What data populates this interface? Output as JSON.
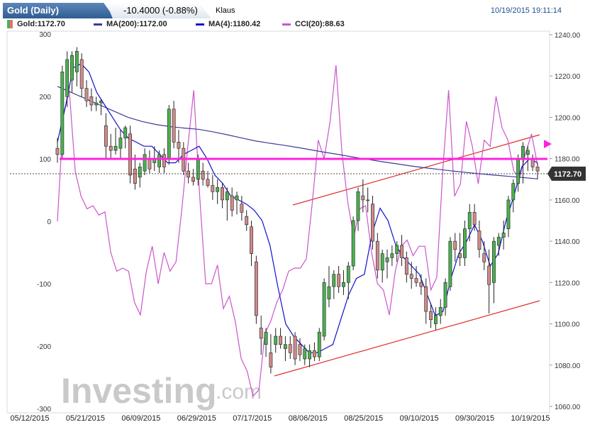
{
  "header": {
    "symbol_label": "Gold (Daily)",
    "change_label": "-10.4000 (-0.88%)",
    "user_label": "Klaus",
    "timestamp": "10/19/2015 19:11:14"
  },
  "watermark": {
    "brand": "Investing",
    "suffix": ".com"
  },
  "chart_data": {
    "type": "line",
    "legend": [
      {
        "label": "Gold:1172.70",
        "color": "#4caf50"
      },
      {
        "label": "MA(200):1172.00",
        "color": "#3b3b9a"
      },
      {
        "label": "MA(4):1180.42",
        "color": "#1010cc"
      },
      {
        "label": "CCI(20):88.63",
        "color": "#cc55cc"
      }
    ],
    "x_tick_labels": [
      "05/12/2015",
      "05/21/2015",
      "06/09/2015",
      "06/29/2015",
      "07/17/2015",
      "08/06/2015",
      "08/25/2015",
      "09/10/2015",
      "09/30/2015",
      "10/19/2015"
    ],
    "price_axis": {
      "ticks": [
        1240,
        1220,
        1200,
        1180,
        1160,
        1140,
        1120,
        1100,
        1080,
        1060
      ],
      "range": [
        1060,
        1240
      ]
    },
    "cci_axis": {
      "ticks": [
        300,
        200,
        100,
        0,
        -100,
        -200,
        -300
      ],
      "range": [
        -300,
        300
      ]
    },
    "last_price": 1172.7,
    "last_price_label": "1172.70",
    "cci_level": 100,
    "candles": [
      {
        "o": 1185,
        "h": 1190,
        "l": 1178,
        "c": 1182
      },
      {
        "o": 1182,
        "h": 1225,
        "l": 1180,
        "c": 1222
      },
      {
        "o": 1210,
        "h": 1232,
        "l": 1205,
        "c": 1228
      },
      {
        "o": 1218,
        "h": 1232,
        "l": 1212,
        "c": 1230
      },
      {
        "o": 1222,
        "h": 1234,
        "l": 1215,
        "c": 1232
      },
      {
        "o": 1228,
        "h": 1231,
        "l": 1210,
        "c": 1214
      },
      {
        "o": 1214,
        "h": 1218,
        "l": 1205,
        "c": 1208
      },
      {
        "o": 1210,
        "h": 1214,
        "l": 1203,
        "c": 1206
      },
      {
        "o": 1206,
        "h": 1210,
        "l": 1203,
        "c": 1207
      },
      {
        "o": 1207,
        "h": 1209,
        "l": 1201,
        "c": 1208
      },
      {
        "o": 1196,
        "h": 1202,
        "l": 1180,
        "c": 1186
      },
      {
        "o": 1186,
        "h": 1192,
        "l": 1180,
        "c": 1184
      },
      {
        "o": 1184,
        "h": 1195,
        "l": 1182,
        "c": 1186
      },
      {
        "o": 1185,
        "h": 1194,
        "l": 1180,
        "c": 1190
      },
      {
        "o": 1190,
        "h": 1196,
        "l": 1185,
        "c": 1195
      },
      {
        "o": 1192,
        "h": 1196,
        "l": 1168,
        "c": 1172
      },
      {
        "o": 1175,
        "h": 1182,
        "l": 1165,
        "c": 1168
      },
      {
        "o": 1171,
        "h": 1178,
        "l": 1166,
        "c": 1176
      },
      {
        "o": 1174,
        "h": 1185,
        "l": 1172,
        "c": 1182
      },
      {
        "o": 1180,
        "h": 1184,
        "l": 1173,
        "c": 1175
      },
      {
        "o": 1178,
        "h": 1186,
        "l": 1174,
        "c": 1180
      },
      {
        "o": 1176,
        "h": 1184,
        "l": 1173,
        "c": 1182
      },
      {
        "o": 1182,
        "h": 1185,
        "l": 1173,
        "c": 1176
      },
      {
        "o": 1180,
        "h": 1206,
        "l": 1177,
        "c": 1204
      },
      {
        "o": 1204,
        "h": 1208,
        "l": 1185,
        "c": 1188
      },
      {
        "o": 1188,
        "h": 1194,
        "l": 1178,
        "c": 1185
      },
      {
        "o": 1185,
        "h": 1188,
        "l": 1172,
        "c": 1174
      },
      {
        "o": 1174,
        "h": 1178,
        "l": 1168,
        "c": 1171
      },
      {
        "o": 1171,
        "h": 1175,
        "l": 1167,
        "c": 1169
      },
      {
        "o": 1170,
        "h": 1182,
        "l": 1167,
        "c": 1180
      },
      {
        "o": 1174,
        "h": 1178,
        "l": 1167,
        "c": 1170
      },
      {
        "o": 1170,
        "h": 1174,
        "l": 1166,
        "c": 1167
      },
      {
        "o": 1167,
        "h": 1172,
        "l": 1160,
        "c": 1164
      },
      {
        "o": 1164,
        "h": 1170,
        "l": 1158,
        "c": 1166
      },
      {
        "o": 1166,
        "h": 1168,
        "l": 1156,
        "c": 1160
      },
      {
        "o": 1160,
        "h": 1166,
        "l": 1150,
        "c": 1164
      },
      {
        "o": 1162,
        "h": 1166,
        "l": 1152,
        "c": 1155
      },
      {
        "o": 1160,
        "h": 1164,
        "l": 1153,
        "c": 1162
      },
      {
        "o": 1158,
        "h": 1162,
        "l": 1150,
        "c": 1154
      },
      {
        "o": 1152,
        "h": 1155,
        "l": 1145,
        "c": 1148
      },
      {
        "o": 1147,
        "h": 1150,
        "l": 1128,
        "c": 1134
      },
      {
        "o": 1130,
        "h": 1133,
        "l": 1100,
        "c": 1104
      },
      {
        "o": 1098,
        "h": 1104,
        "l": 1085,
        "c": 1093
      },
      {
        "o": 1090,
        "h": 1098,
        "l": 1084,
        "c": 1096
      },
      {
        "o": 1086,
        "h": 1095,
        "l": 1076,
        "c": 1079
      },
      {
        "o": 1090,
        "h": 1098,
        "l": 1086,
        "c": 1094
      },
      {
        "o": 1094,
        "h": 1098,
        "l": 1088,
        "c": 1090
      },
      {
        "o": 1088,
        "h": 1094,
        "l": 1082,
        "c": 1090
      },
      {
        "o": 1090,
        "h": 1094,
        "l": 1083,
        "c": 1086
      },
      {
        "o": 1094,
        "h": 1096,
        "l": 1080,
        "c": 1083
      },
      {
        "o": 1090,
        "h": 1093,
        "l": 1082,
        "c": 1085
      },
      {
        "o": 1083,
        "h": 1090,
        "l": 1080,
        "c": 1088
      },
      {
        "o": 1083,
        "h": 1090,
        "l": 1079,
        "c": 1087
      },
      {
        "o": 1087,
        "h": 1091,
        "l": 1082,
        "c": 1084
      },
      {
        "o": 1084,
        "h": 1098,
        "l": 1082,
        "c": 1096
      },
      {
        "o": 1094,
        "h": 1122,
        "l": 1092,
        "c": 1120
      },
      {
        "o": 1112,
        "h": 1128,
        "l": 1108,
        "c": 1118
      },
      {
        "o": 1118,
        "h": 1126,
        "l": 1112,
        "c": 1124
      },
      {
        "o": 1124,
        "h": 1128,
        "l": 1115,
        "c": 1118
      },
      {
        "o": 1118,
        "h": 1126,
        "l": 1114,
        "c": 1120
      },
      {
        "o": 1120,
        "h": 1130,
        "l": 1112,
        "c": 1128
      },
      {
        "o": 1128,
        "h": 1152,
        "l": 1126,
        "c": 1150
      },
      {
        "o": 1150,
        "h": 1166,
        "l": 1145,
        "c": 1164
      },
      {
        "o": 1162,
        "h": 1170,
        "l": 1154,
        "c": 1160
      },
      {
        "o": 1160,
        "h": 1166,
        "l": 1154,
        "c": 1160
      },
      {
        "o": 1158,
        "h": 1162,
        "l": 1136,
        "c": 1140
      },
      {
        "o": 1140,
        "h": 1144,
        "l": 1122,
        "c": 1126
      },
      {
        "o": 1126,
        "h": 1136,
        "l": 1120,
        "c": 1134
      },
      {
        "o": 1130,
        "h": 1136,
        "l": 1122,
        "c": 1132
      },
      {
        "o": 1132,
        "h": 1138,
        "l": 1128,
        "c": 1134
      },
      {
        "o": 1134,
        "h": 1140,
        "l": 1130,
        "c": 1138
      },
      {
        "o": 1138,
        "h": 1143,
        "l": 1128,
        "c": 1132
      },
      {
        "o": 1132,
        "h": 1135,
        "l": 1120,
        "c": 1124
      },
      {
        "o": 1124,
        "h": 1130,
        "l": 1117,
        "c": 1122
      },
      {
        "o": 1122,
        "h": 1128,
        "l": 1118,
        "c": 1120
      },
      {
        "o": 1120,
        "h": 1124,
        "l": 1114,
        "c": 1118
      },
      {
        "o": 1118,
        "h": 1122,
        "l": 1100,
        "c": 1106
      },
      {
        "o": 1106,
        "h": 1110,
        "l": 1098,
        "c": 1102
      },
      {
        "o": 1100,
        "h": 1108,
        "l": 1097,
        "c": 1104
      },
      {
        "o": 1104,
        "h": 1112,
        "l": 1100,
        "c": 1108
      },
      {
        "o": 1108,
        "h": 1122,
        "l": 1104,
        "c": 1120
      },
      {
        "o": 1118,
        "h": 1142,
        "l": 1116,
        "c": 1140
      },
      {
        "o": 1140,
        "h": 1144,
        "l": 1130,
        "c": 1136
      },
      {
        "o": 1134,
        "h": 1144,
        "l": 1128,
        "c": 1132
      },
      {
        "o": 1132,
        "h": 1150,
        "l": 1128,
        "c": 1146
      },
      {
        "o": 1146,
        "h": 1158,
        "l": 1140,
        "c": 1154
      },
      {
        "o": 1154,
        "h": 1158,
        "l": 1145,
        "c": 1148
      },
      {
        "o": 1145,
        "h": 1150,
        "l": 1132,
        "c": 1136
      },
      {
        "o": 1134,
        "h": 1140,
        "l": 1126,
        "c": 1130
      },
      {
        "o": 1128,
        "h": 1136,
        "l": 1105,
        "c": 1119
      },
      {
        "o": 1120,
        "h": 1142,
        "l": 1110,
        "c": 1140
      },
      {
        "o": 1138,
        "h": 1144,
        "l": 1133,
        "c": 1142
      },
      {
        "o": 1142,
        "h": 1150,
        "l": 1136,
        "c": 1144
      },
      {
        "o": 1146,
        "h": 1162,
        "l": 1142,
        "c": 1160
      },
      {
        "o": 1160,
        "h": 1170,
        "l": 1154,
        "c": 1168
      },
      {
        "o": 1168,
        "h": 1182,
        "l": 1164,
        "c": 1180
      },
      {
        "o": 1180,
        "h": 1188,
        "l": 1168,
        "c": 1186
      },
      {
        "o": 1182,
        "h": 1186,
        "l": 1174,
        "c": 1184
      },
      {
        "o": 1180,
        "h": 1182,
        "l": 1174,
        "c": 1176
      },
      {
        "o": 1176,
        "h": 1178,
        "l": 1170,
        "c": 1174
      }
    ],
    "ma200": [
      1215,
      1212,
      1209,
      1206,
      1203,
      1200,
      1198,
      1196.5,
      1195.5,
      1194.8,
      1194.2,
      1193,
      1191.6,
      1190.1,
      1188.6,
      1187.5,
      1186.5,
      1185.4,
      1184.2,
      1183,
      1181.9,
      1180.7,
      1179.6,
      1178.5,
      1177.5,
      1176.5,
      1175.6,
      1174.8,
      1174,
      1173.3,
      1172.6,
      1172,
      1171.4,
      1170.8,
      1170.2
    ],
    "ma4": [
      1188,
      1205,
      1224,
      1226,
      1222,
      1212,
      1206,
      1200,
      1194,
      1190,
      1188,
      1186,
      1186,
      1182,
      1178,
      1178,
      1182,
      1184,
      1186,
      1180,
      1172,
      1168,
      1162,
      1160,
      1158,
      1155,
      1150,
      1138,
      1118,
      1100,
      1094,
      1090,
      1086,
      1086,
      1088,
      1090,
      1102,
      1114,
      1122,
      1124,
      1144,
      1156,
      1150,
      1138,
      1132,
      1128,
      1124,
      1114,
      1104,
      1106,
      1122,
      1134,
      1140,
      1148,
      1140,
      1128,
      1134,
      1150,
      1162,
      1176,
      1180,
      1178
    ],
    "cci": [
      0,
      170,
      210,
      80,
      40,
      20,
      25,
      10,
      15,
      -50,
      -80,
      -75,
      -80,
      -130,
      -150,
      -80,
      -40,
      -100,
      -50,
      -80,
      -65,
      20,
      120,
      210,
      40,
      -100,
      -100,
      -70,
      -140,
      -120,
      -160,
      -220,
      -240,
      -280,
      -270,
      -180,
      -160,
      -130,
      -110,
      -80,
      -75,
      -75,
      -60,
      30,
      130,
      100,
      160,
      250,
      110,
      30,
      -25,
      20,
      25,
      -50,
      -100,
      -110,
      -150,
      -80,
      -40,
      -30,
      -55,
      -40,
      -40,
      -110,
      -90,
      80,
      210,
      40,
      60,
      160,
      120,
      60,
      130,
      120,
      200,
      150,
      130,
      80,
      70,
      110,
      140,
      90
    ]
  }
}
